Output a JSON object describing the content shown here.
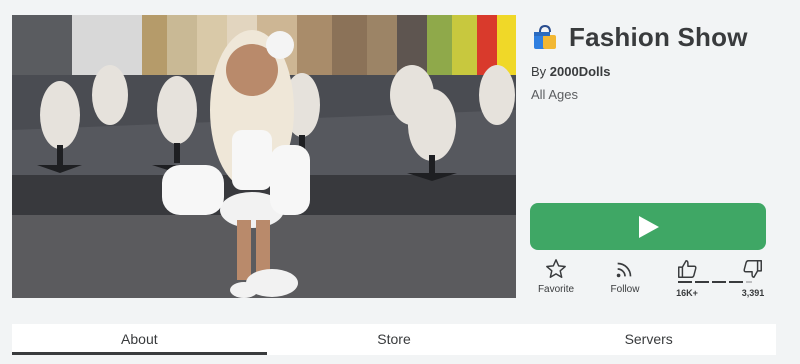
{
  "game": {
    "title": "Fashion Show",
    "icon": "shopping-bag-icon",
    "creator_prefix": "By",
    "creator_name": "2000Dolls",
    "age_rating": "All Ages"
  },
  "play_button": {
    "icon": "play-icon",
    "color": "#3fa765"
  },
  "actions": {
    "favorite_label": "Favorite",
    "follow_label": "Follow",
    "upvotes": "16K+",
    "downvotes": "3,391"
  },
  "tabs": [
    {
      "label": "About",
      "active": true
    },
    {
      "label": "Store",
      "active": false
    },
    {
      "label": "Servers",
      "active": false
    }
  ],
  "colors": {
    "background": "#f2f4f5",
    "text": "#393b3d",
    "accent": "#3fa765"
  }
}
